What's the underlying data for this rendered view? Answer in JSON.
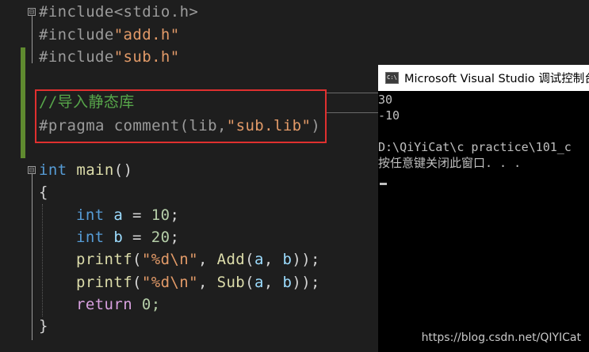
{
  "editor": {
    "lines": {
      "include_stdio": {
        "directive": "#include",
        "header": "<stdio.h>"
      },
      "include_add": {
        "directive": "#include",
        "header": "\"add.h\""
      },
      "include_sub": {
        "directive": "#include",
        "header": "\"sub.h\""
      },
      "comment": "//导入静态库",
      "pragma": {
        "directive": "#pragma comment(lib,",
        "arg": "\"sub.lib\"",
        "close": ")"
      },
      "main_sig": {
        "type": "int",
        "name": "main",
        "parens": "()"
      },
      "open_brace": "{",
      "decl_a": {
        "type": "int",
        "var": "a",
        "op": " = ",
        "value": "10",
        "end": ";"
      },
      "decl_b": {
        "type": "int",
        "var": "b",
        "op": " = ",
        "value": "20",
        "end": ";"
      },
      "printf_add": {
        "fn": "printf",
        "open": "(",
        "fmt": "\"%d\\n\"",
        "sep": ", ",
        "call": "Add",
        "args_open": "(",
        "a": "a",
        "comma": ", ",
        "b": "b",
        "close": "));"
      },
      "printf_sub": {
        "fn": "printf",
        "open": "(",
        "fmt": "\"%d\\n\"",
        "sep": ", ",
        "call": "Sub",
        "args_open": "(",
        "a": "a",
        "comma": ", ",
        "b": "b",
        "close": "));"
      },
      "return_stmt": {
        "kw": "return",
        "value": " 0;"
      },
      "close_brace": "}"
    },
    "fold_symbol": "⊟"
  },
  "console": {
    "icon_text": "C:\\",
    "title": "Microsoft Visual Studio 调试控制台",
    "output": [
      "30",
      "-10",
      "",
      "D:\\QiYiCat\\c practice\\101_c",
      "按任意键关闭此窗口. . ."
    ]
  },
  "watermark": "https://blog.csdn.net/QIYICat",
  "colors": {
    "highlight_box": "#e0302f",
    "change_bar": "#5f8a2f",
    "editor_bg": "#1e1e1e",
    "console_bg": "#000000"
  }
}
